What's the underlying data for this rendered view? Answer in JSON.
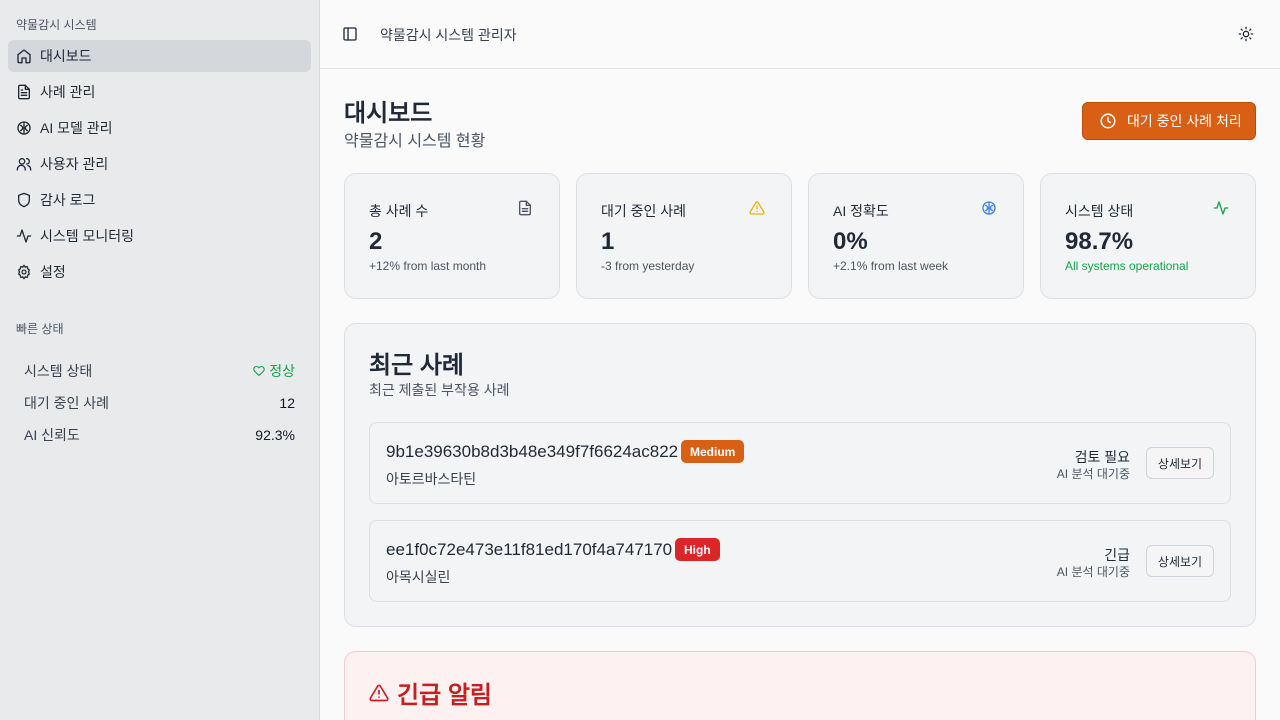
{
  "sidebar": {
    "app_title": "약물감시 시스템",
    "items": [
      {
        "label": "대시보드",
        "icon": "home-icon"
      },
      {
        "label": "사례 관리",
        "icon": "file-icon"
      },
      {
        "label": "AI 모델 관리",
        "icon": "brain-icon"
      },
      {
        "label": "사용자 관리",
        "icon": "users-icon"
      },
      {
        "label": "감사 로그",
        "icon": "shield-icon"
      },
      {
        "label": "시스템 모니터링",
        "icon": "activity-icon"
      },
      {
        "label": "설정",
        "icon": "gear-icon"
      }
    ],
    "quick_status": {
      "label": "빠른 상태",
      "rows": [
        {
          "label": "시스템 상태",
          "value": "정상"
        },
        {
          "label": "대기 중인 사례",
          "value": "12"
        },
        {
          "label": "AI 신뢰도",
          "value": "92.3%"
        }
      ]
    }
  },
  "header": {
    "title": "약물감시 시스템 관리자"
  },
  "main": {
    "title": "대시보드",
    "subtitle": "약물감시 시스템 현황",
    "pending_button": "대기 중인 사례 처리",
    "cards": [
      {
        "label": "총 사례 수",
        "value": "2",
        "note": "+12% from last month",
        "icon": "document-icon"
      },
      {
        "label": "대기 중인 사례",
        "value": "1",
        "note": "-3 from yesterday",
        "icon": "warning-icon"
      },
      {
        "label": "AI 정확도",
        "value": "0%",
        "note": "+2.1% from last week",
        "icon": "brain-icon"
      },
      {
        "label": "시스템 상태",
        "value": "98.7%",
        "note": "All systems operational",
        "icon": "activity-icon"
      }
    ],
    "recent": {
      "title": "최근 사례",
      "subtitle": "최근 제출된 부작용 사례",
      "cases": [
        {
          "id": "9b1e39630b8d3b48e349f7f6624ac822",
          "severity": "Medium",
          "drug": "아토르바스타틴",
          "status": "검토 필요",
          "ai": "AI 분석 대기중",
          "detail": "상세보기"
        },
        {
          "id": "ee1f0c72e473e11f81ed170f4a747170",
          "severity": "High",
          "drug": "아목시실린",
          "status": "긴급",
          "ai": "AI 분석 대기중",
          "detail": "상세보기"
        }
      ]
    },
    "urgent": {
      "title": "긴급 알림"
    }
  },
  "colors": {
    "accent": "#d95f14",
    "medium_badge": "#d95f14",
    "high_badge": "#dc2626",
    "ok": "#16a34a",
    "urgent": "#c81e1e"
  }
}
